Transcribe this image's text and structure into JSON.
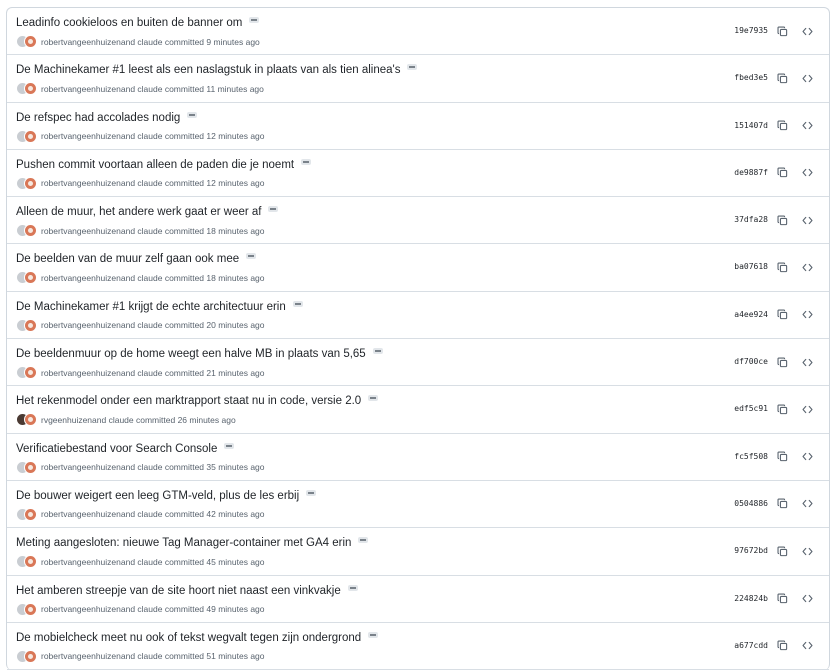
{
  "commits": [
    {
      "title": "Leadinfo cookieloos en buiten de banner om",
      "author": "robertvangeenhuizen",
      "meta_suffix": " and claude committed 9 minutes ago",
      "sha": "19e7935",
      "avatar": "grey"
    },
    {
      "title": "De Machinekamer #1 leest als een naslagstuk in plaats van als tien alinea's",
      "author": "robertvangeenhuizen",
      "meta_suffix": " and claude committed 11 minutes ago",
      "sha": "fbed3e5",
      "avatar": "grey"
    },
    {
      "title": "De refspec had accolades nodig",
      "author": "robertvangeenhuizen",
      "meta_suffix": " and claude committed 12 minutes ago",
      "sha": "151407d",
      "avatar": "grey"
    },
    {
      "title": "Pushen commit voortaan alleen de paden die je noemt",
      "author": "robertvangeenhuizen",
      "meta_suffix": " and claude committed 12 minutes ago",
      "sha": "de9887f",
      "avatar": "grey"
    },
    {
      "title": "Alleen de muur, het andere werk gaat er weer af",
      "author": "robertvangeenhuizen",
      "meta_suffix": " and claude committed 18 minutes ago",
      "sha": "37dfa28",
      "avatar": "grey"
    },
    {
      "title": "De beelden van de muur zelf gaan ook mee",
      "author": "robertvangeenhuizen",
      "meta_suffix": " and claude committed 18 minutes ago",
      "sha": "ba07618",
      "avatar": "grey"
    },
    {
      "title": "De Machinekamer #1 krijgt de echte architectuur erin",
      "author": "robertvangeenhuizen",
      "meta_suffix": " and claude committed 20 minutes ago",
      "sha": "a4ee924",
      "avatar": "grey"
    },
    {
      "title": "De beeldenmuur op de home weegt een halve MB in plaats van 5,65",
      "author": "robertvangeenhuizen",
      "meta_suffix": " and claude committed 21 minutes ago",
      "sha": "df700ce",
      "avatar": "grey"
    },
    {
      "title": "Het rekenmodel onder een marktrapport staat nu in code, versie 2.0",
      "author": "rvgeenhuizen",
      "meta_suffix": " and claude committed 26 minutes ago",
      "sha": "edf5c91",
      "avatar": "dark"
    },
    {
      "title": "Verificatiebestand voor Search Console",
      "author": "robertvangeenhuizen",
      "meta_suffix": " and claude committed 35 minutes ago",
      "sha": "fc5f508",
      "avatar": "grey"
    },
    {
      "title": "De bouwer weigert een leeg GTM-veld, plus de les erbij",
      "author": "robertvangeenhuizen",
      "meta_suffix": " and claude committed 42 minutes ago",
      "sha": "0504886",
      "avatar": "grey"
    },
    {
      "title": "Meting aangesloten: nieuwe Tag Manager-container met GA4 erin",
      "author": "robertvangeenhuizen",
      "meta_suffix": " and claude committed 45 minutes ago",
      "sha": "97672bd",
      "avatar": "grey"
    },
    {
      "title": "Het amberen streepje van de site hoort niet naast een vinkvakje",
      "author": "robertvangeenhuizen",
      "meta_suffix": " and claude committed 49 minutes ago",
      "sha": "224824b",
      "avatar": "grey"
    },
    {
      "title": "De mobielcheck meet nu ook of tekst wegvalt tegen zijn ondergrond",
      "author": "robertvangeenhuizen",
      "meta_suffix": " and claude committed 51 minutes ago",
      "sha": "a677cdd",
      "avatar": "grey"
    }
  ],
  "colors": {
    "border": "#d0d7de",
    "text": "#1f2328",
    "muted": "#59636e",
    "claude_avatar": "#d97757"
  },
  "icons": {
    "copy": "copy-icon",
    "browse": "code-icon",
    "more": "kebab-horizontal-icon"
  }
}
